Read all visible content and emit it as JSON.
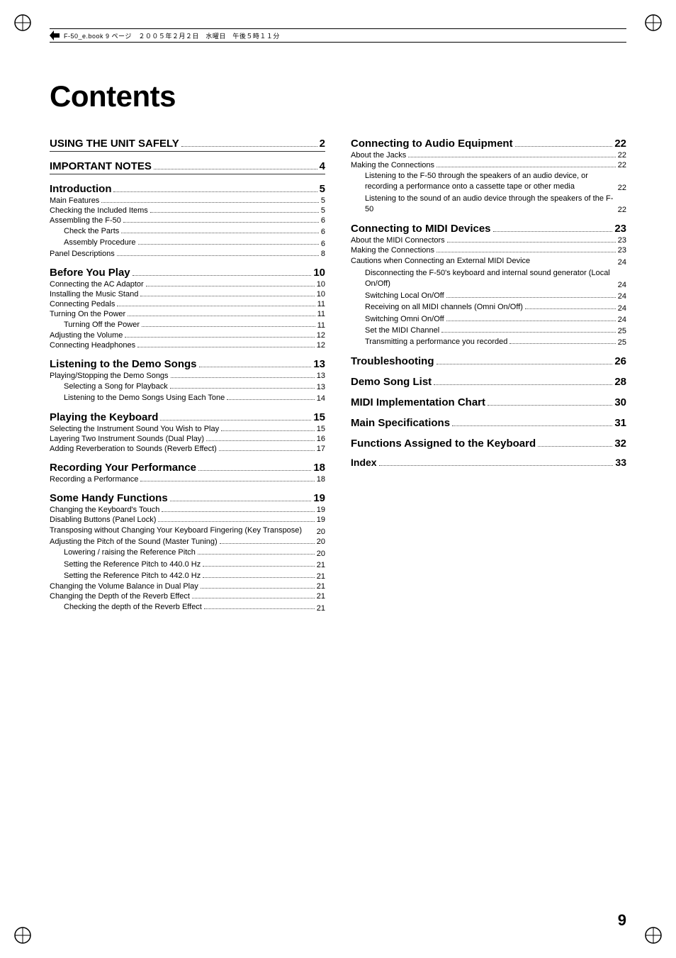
{
  "page": {
    "title": "Contents",
    "page_number": "9",
    "header_text": "F-50_e.book 9 ページ　２００５年２月２日　水曜日　午後５時１１分"
  },
  "left_col": [
    {
      "type": "section",
      "label": "USING THE UNIT SAFELY",
      "dots": true,
      "page": "2",
      "bold": true
    },
    {
      "type": "section",
      "label": "IMPORTANT NOTES",
      "dots": true,
      "page": "4",
      "bold": true
    },
    {
      "type": "section",
      "label": "Introduction",
      "dots": true,
      "page": "5",
      "bold": true
    },
    {
      "type": "item",
      "label": "Main Features",
      "page": "5"
    },
    {
      "type": "item",
      "label": "Checking the Included Items",
      "page": "5"
    },
    {
      "type": "item",
      "label": "Assembling the F-50",
      "page": "6"
    },
    {
      "type": "subitem",
      "label": "Check the Parts",
      "page": "6"
    },
    {
      "type": "subitem",
      "label": "Assembly Procedure",
      "page": "6"
    },
    {
      "type": "item",
      "label": "Panel Descriptions",
      "page": "8"
    },
    {
      "type": "section",
      "label": "Before You Play",
      "dots": true,
      "page": "10",
      "bold": true
    },
    {
      "type": "item",
      "label": "Connecting the AC Adaptor",
      "page": "10"
    },
    {
      "type": "item",
      "label": "Installing the Music Stand",
      "page": "10"
    },
    {
      "type": "item",
      "label": "Connecting Pedals",
      "page": "11"
    },
    {
      "type": "item",
      "label": "Turning On the Power",
      "page": "11"
    },
    {
      "type": "subitem",
      "label": "Turning Off the Power",
      "page": "11"
    },
    {
      "type": "item",
      "label": "Adjusting the Volume",
      "page": "12"
    },
    {
      "type": "item",
      "label": "Connecting Headphones",
      "page": "12"
    },
    {
      "type": "section",
      "label": "Listening to the Demo Songs",
      "dots": true,
      "page": "13",
      "bold": true
    },
    {
      "type": "item",
      "label": "Playing/Stopping the Demo Songs",
      "page": "13"
    },
    {
      "type": "subitem",
      "label": "Selecting a Song for Playback",
      "page": "13"
    },
    {
      "type": "subitem",
      "label": "Listening to the Demo Songs Using Each Tone",
      "page": "14"
    },
    {
      "type": "section",
      "label": "Playing the Keyboard",
      "dots": true,
      "page": "15",
      "bold": true
    },
    {
      "type": "item",
      "label": "Selecting the Instrument Sound You Wish to Play",
      "page": "15"
    },
    {
      "type": "item",
      "label": "Layering Two Instrument Sounds (Dual Play)",
      "page": "16"
    },
    {
      "type": "item",
      "label": "Adding Reverberation to Sounds (Reverb Effect)",
      "page": "17"
    },
    {
      "type": "section",
      "label": "Recording Your Performance",
      "dots": true,
      "page": "18",
      "bold": true
    },
    {
      "type": "item",
      "label": "Recording a Performance",
      "page": "18"
    },
    {
      "type": "section",
      "label": "Some Handy Functions",
      "dots": true,
      "page": "19",
      "bold": true
    },
    {
      "type": "item",
      "label": "Changing the Keyboard's Touch",
      "page": "19"
    },
    {
      "type": "item",
      "label": "Disabling Buttons (Panel Lock)",
      "page": "19"
    },
    {
      "type": "item_wrap",
      "label": "Transposing without Changing Your Keyboard Fingering (Key Transpose)",
      "page": "20"
    },
    {
      "type": "item",
      "label": "Adjusting the Pitch of the Sound (Master Tuning)",
      "page": "20"
    },
    {
      "type": "subitem",
      "label": "Lowering / raising the Reference Pitch",
      "page": "20"
    },
    {
      "type": "subitem",
      "label": "Setting the Reference Pitch to 440.0 Hz",
      "page": "21"
    },
    {
      "type": "subitem",
      "label": "Setting the Reference Pitch to 442.0 Hz",
      "page": "21"
    },
    {
      "type": "item",
      "label": "Changing the Volume Balance in Dual Play",
      "page": "21"
    },
    {
      "type": "item",
      "label": "Changing the Depth of the Reverb Effect",
      "page": "21"
    },
    {
      "type": "subitem",
      "label": "Checking the depth of the Reverb Effect",
      "page": "21"
    }
  ],
  "right_col": [
    {
      "type": "section",
      "label": "Connecting to Audio Equipment",
      "dots": true,
      "page": "22",
      "bold": true
    },
    {
      "type": "item",
      "label": "About the Jacks",
      "page": "22"
    },
    {
      "type": "item",
      "label": "Making the Connections",
      "page": "22"
    },
    {
      "type": "subitem_wrap",
      "label": "Listening to the F-50 through the speakers of an audio device, or recording a performance onto a cassette tape or other media",
      "page": "22"
    },
    {
      "type": "subitem_wrap",
      "label": "Listening to the sound of an audio device through the speakers of the F-50",
      "page": "22"
    },
    {
      "type": "section",
      "label": "Connecting to MIDI Devices",
      "dots": true,
      "page": "23",
      "bold": true
    },
    {
      "type": "item",
      "label": "About the MIDI Connectors",
      "page": "23"
    },
    {
      "type": "item",
      "label": "Making the Connections",
      "page": "23"
    },
    {
      "type": "item_wrap",
      "label": "Cautions when Connecting an External MIDI Device",
      "page": "24"
    },
    {
      "type": "subitem_wrap",
      "label": "Disconnecting the F-50's keyboard and internal sound generator (Local On/Off)",
      "page": "24"
    },
    {
      "type": "subitem",
      "label": "Switching Local On/Off",
      "page": "24"
    },
    {
      "type": "subitem",
      "label": "Receiving on all MIDI channels (Omni On/Off)",
      "page": "24"
    },
    {
      "type": "subitem",
      "label": "Switching Omni On/Off",
      "page": "24"
    },
    {
      "type": "subitem",
      "label": "Set the MIDI Channel",
      "page": "25"
    },
    {
      "type": "subitem",
      "label": "Transmitting a performance you recorded",
      "page": "25"
    },
    {
      "type": "section",
      "label": "Troubleshooting",
      "dots": true,
      "page": "26",
      "bold": true
    },
    {
      "type": "section",
      "label": "Demo Song List",
      "dots": true,
      "page": "28",
      "bold": true
    },
    {
      "type": "section",
      "label": "MIDI Implementation Chart",
      "dots": true,
      "page": "30",
      "bold": true
    },
    {
      "type": "section",
      "label": "Main Specifications",
      "dots": true,
      "page": "31",
      "bold": true
    },
    {
      "type": "section",
      "label": "Functions Assigned to the Keyboard",
      "dots": true,
      "page": "32",
      "bold": true
    },
    {
      "type": "section",
      "label": "Index",
      "dots": true,
      "page": "33",
      "bold": false
    }
  ]
}
